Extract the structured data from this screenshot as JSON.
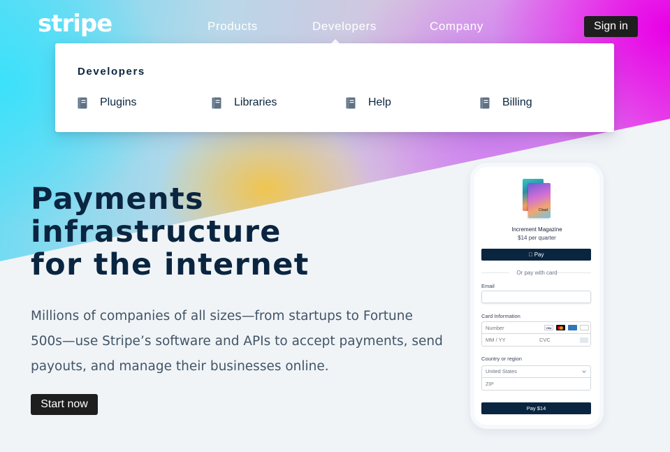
{
  "header": {
    "logo": "stripe",
    "nav": [
      "Products",
      "Developers",
      "Company"
    ],
    "sign_in": "Sign in"
  },
  "dropdown": {
    "title": "Developers",
    "items": [
      {
        "label": "Plugins",
        "icon": "book-icon"
      },
      {
        "label": "Libraries",
        "icon": "book-icon"
      },
      {
        "label": "Help",
        "icon": "book-icon"
      },
      {
        "label": "Billing",
        "icon": "book-icon"
      }
    ]
  },
  "hero": {
    "headline_lines": [
      "Payments",
      "infrastructure",
      "for the internet"
    ],
    "subtext": "Millions of companies of all sizes—from startups to Fortune 500s—use Stripe’s software and APIs to accept payments, send payouts, and manage their businesses online.",
    "cta": "Start now"
  },
  "checkout": {
    "product_name": "Increment Magazine",
    "product_price": "$14 per quarter",
    "magazine_label": "Cloud",
    "apple_pay": " Pay",
    "or_text": "Or pay with card",
    "email_label": "Email",
    "card_label": "Card Information",
    "card_number_placeholder": "Number",
    "expiry_placeholder": "MM / YY",
    "cvc_placeholder": "CVC",
    "country_label": "Country or region",
    "country_value": "United States",
    "zip_placeholder": "ZIP",
    "pay_button": "Pay $14",
    "card_brands": [
      "VISA",
      "mastercard",
      "amex",
      "discover"
    ]
  },
  "colors": {
    "navy": "#0a2540",
    "slate": "#425466",
    "button_dark": "#1e1e1e",
    "gradient_cyan": "#61dcf5",
    "gradient_magenta": "#e83be8",
    "gradient_yellow": "#f2c448"
  }
}
